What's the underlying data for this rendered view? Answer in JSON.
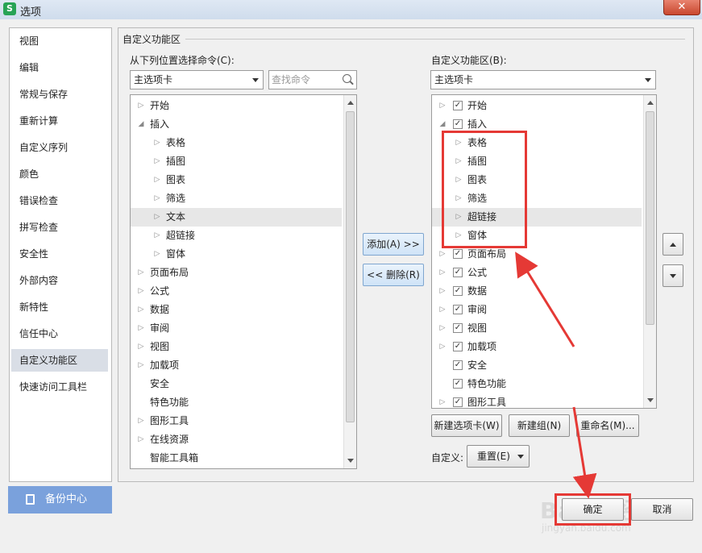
{
  "window": {
    "title": "选项",
    "app_icon": "S",
    "close_glyph": "✕"
  },
  "nav": {
    "items": [
      "视图",
      "编辑",
      "常规与保存",
      "重新计算",
      "自定义序列",
      "颜色",
      "错误检查",
      "拼写检查",
      "安全性",
      "外部内容",
      "新特性",
      "信任中心",
      "自定义功能区",
      "快速访问工具栏"
    ],
    "selected": "自定义功能区"
  },
  "backup": {
    "label": "备份中心"
  },
  "main": {
    "group_title": "自定义功能区",
    "left_label": "从下列位置选择命令(C):",
    "left_combo": "主选项卡",
    "search_placeholder": "查找命令",
    "right_label": "自定义功能区(B):",
    "right_combo": "主选项卡",
    "left_tree": [
      {
        "label": "开始",
        "level": 0,
        "expand": "closed"
      },
      {
        "label": "插入",
        "level": 0,
        "expand": "open"
      },
      {
        "label": "表格",
        "level": 1,
        "expand": "closed"
      },
      {
        "label": "插图",
        "level": 1,
        "expand": "closed"
      },
      {
        "label": "图表",
        "level": 1,
        "expand": "closed"
      },
      {
        "label": "筛选",
        "level": 1,
        "expand": "closed"
      },
      {
        "label": "文本",
        "level": 1,
        "expand": "closed",
        "highlight": true
      },
      {
        "label": "超链接",
        "level": 1,
        "expand": "closed"
      },
      {
        "label": "窗体",
        "level": 1,
        "expand": "closed"
      },
      {
        "label": "页面布局",
        "level": 0,
        "expand": "closed"
      },
      {
        "label": "公式",
        "level": 0,
        "expand": "closed"
      },
      {
        "label": "数据",
        "level": 0,
        "expand": "closed"
      },
      {
        "label": "审阅",
        "level": 0,
        "expand": "closed"
      },
      {
        "label": "视图",
        "level": 0,
        "expand": "closed"
      },
      {
        "label": "加载项",
        "level": 0,
        "expand": "closed"
      },
      {
        "label": "安全",
        "level": 0,
        "expand": "none"
      },
      {
        "label": "特色功能",
        "level": 0,
        "expand": "none"
      },
      {
        "label": "图形工具",
        "level": 0,
        "expand": "closed"
      },
      {
        "label": "在线资源",
        "level": 0,
        "expand": "closed"
      },
      {
        "label": "智能工具箱",
        "level": 0,
        "expand": "none"
      }
    ],
    "right_tree": [
      {
        "label": "开始",
        "level": 0,
        "expand": "closed",
        "checked": true
      },
      {
        "label": "插入",
        "level": 0,
        "expand": "open",
        "checked": true
      },
      {
        "label": "表格",
        "level": 1,
        "expand": "closed"
      },
      {
        "label": "插图",
        "level": 1,
        "expand": "closed"
      },
      {
        "label": "图表",
        "level": 1,
        "expand": "closed"
      },
      {
        "label": "筛选",
        "level": 1,
        "expand": "closed"
      },
      {
        "label": "超链接",
        "level": 1,
        "expand": "closed",
        "highlight": true
      },
      {
        "label": "窗体",
        "level": 1,
        "expand": "closed"
      },
      {
        "label": "页面布局",
        "level": 0,
        "expand": "closed",
        "checked": true
      },
      {
        "label": "公式",
        "level": 0,
        "expand": "closed",
        "checked": true
      },
      {
        "label": "数据",
        "level": 0,
        "expand": "closed",
        "checked": true
      },
      {
        "label": "审阅",
        "level": 0,
        "expand": "closed",
        "checked": true
      },
      {
        "label": "视图",
        "level": 0,
        "expand": "closed",
        "checked": true
      },
      {
        "label": "加载项",
        "level": 0,
        "expand": "closed",
        "checked": true
      },
      {
        "label": "安全",
        "level": 0,
        "expand": "none",
        "checked": true
      },
      {
        "label": "特色功能",
        "level": 0,
        "expand": "none",
        "checked": true
      },
      {
        "label": "图形工具",
        "level": 0,
        "expand": "closed",
        "checked": true
      }
    ],
    "add_button": "添加(A) >>",
    "remove_button": "<< 删除(R)",
    "new_tab_button": "新建选项卡(W)",
    "new_group_button": "新建组(N)",
    "rename_button": "重命名(M)...",
    "custom_label": "自定义:",
    "reset_button": "重置(E)"
  },
  "footer": {
    "ok_button": "确定",
    "cancel_button": "取消"
  },
  "watermark": {
    "text": "Baidu经验",
    "sub": "jingyan.baidu.com"
  },
  "annotation_color": "#e53935"
}
